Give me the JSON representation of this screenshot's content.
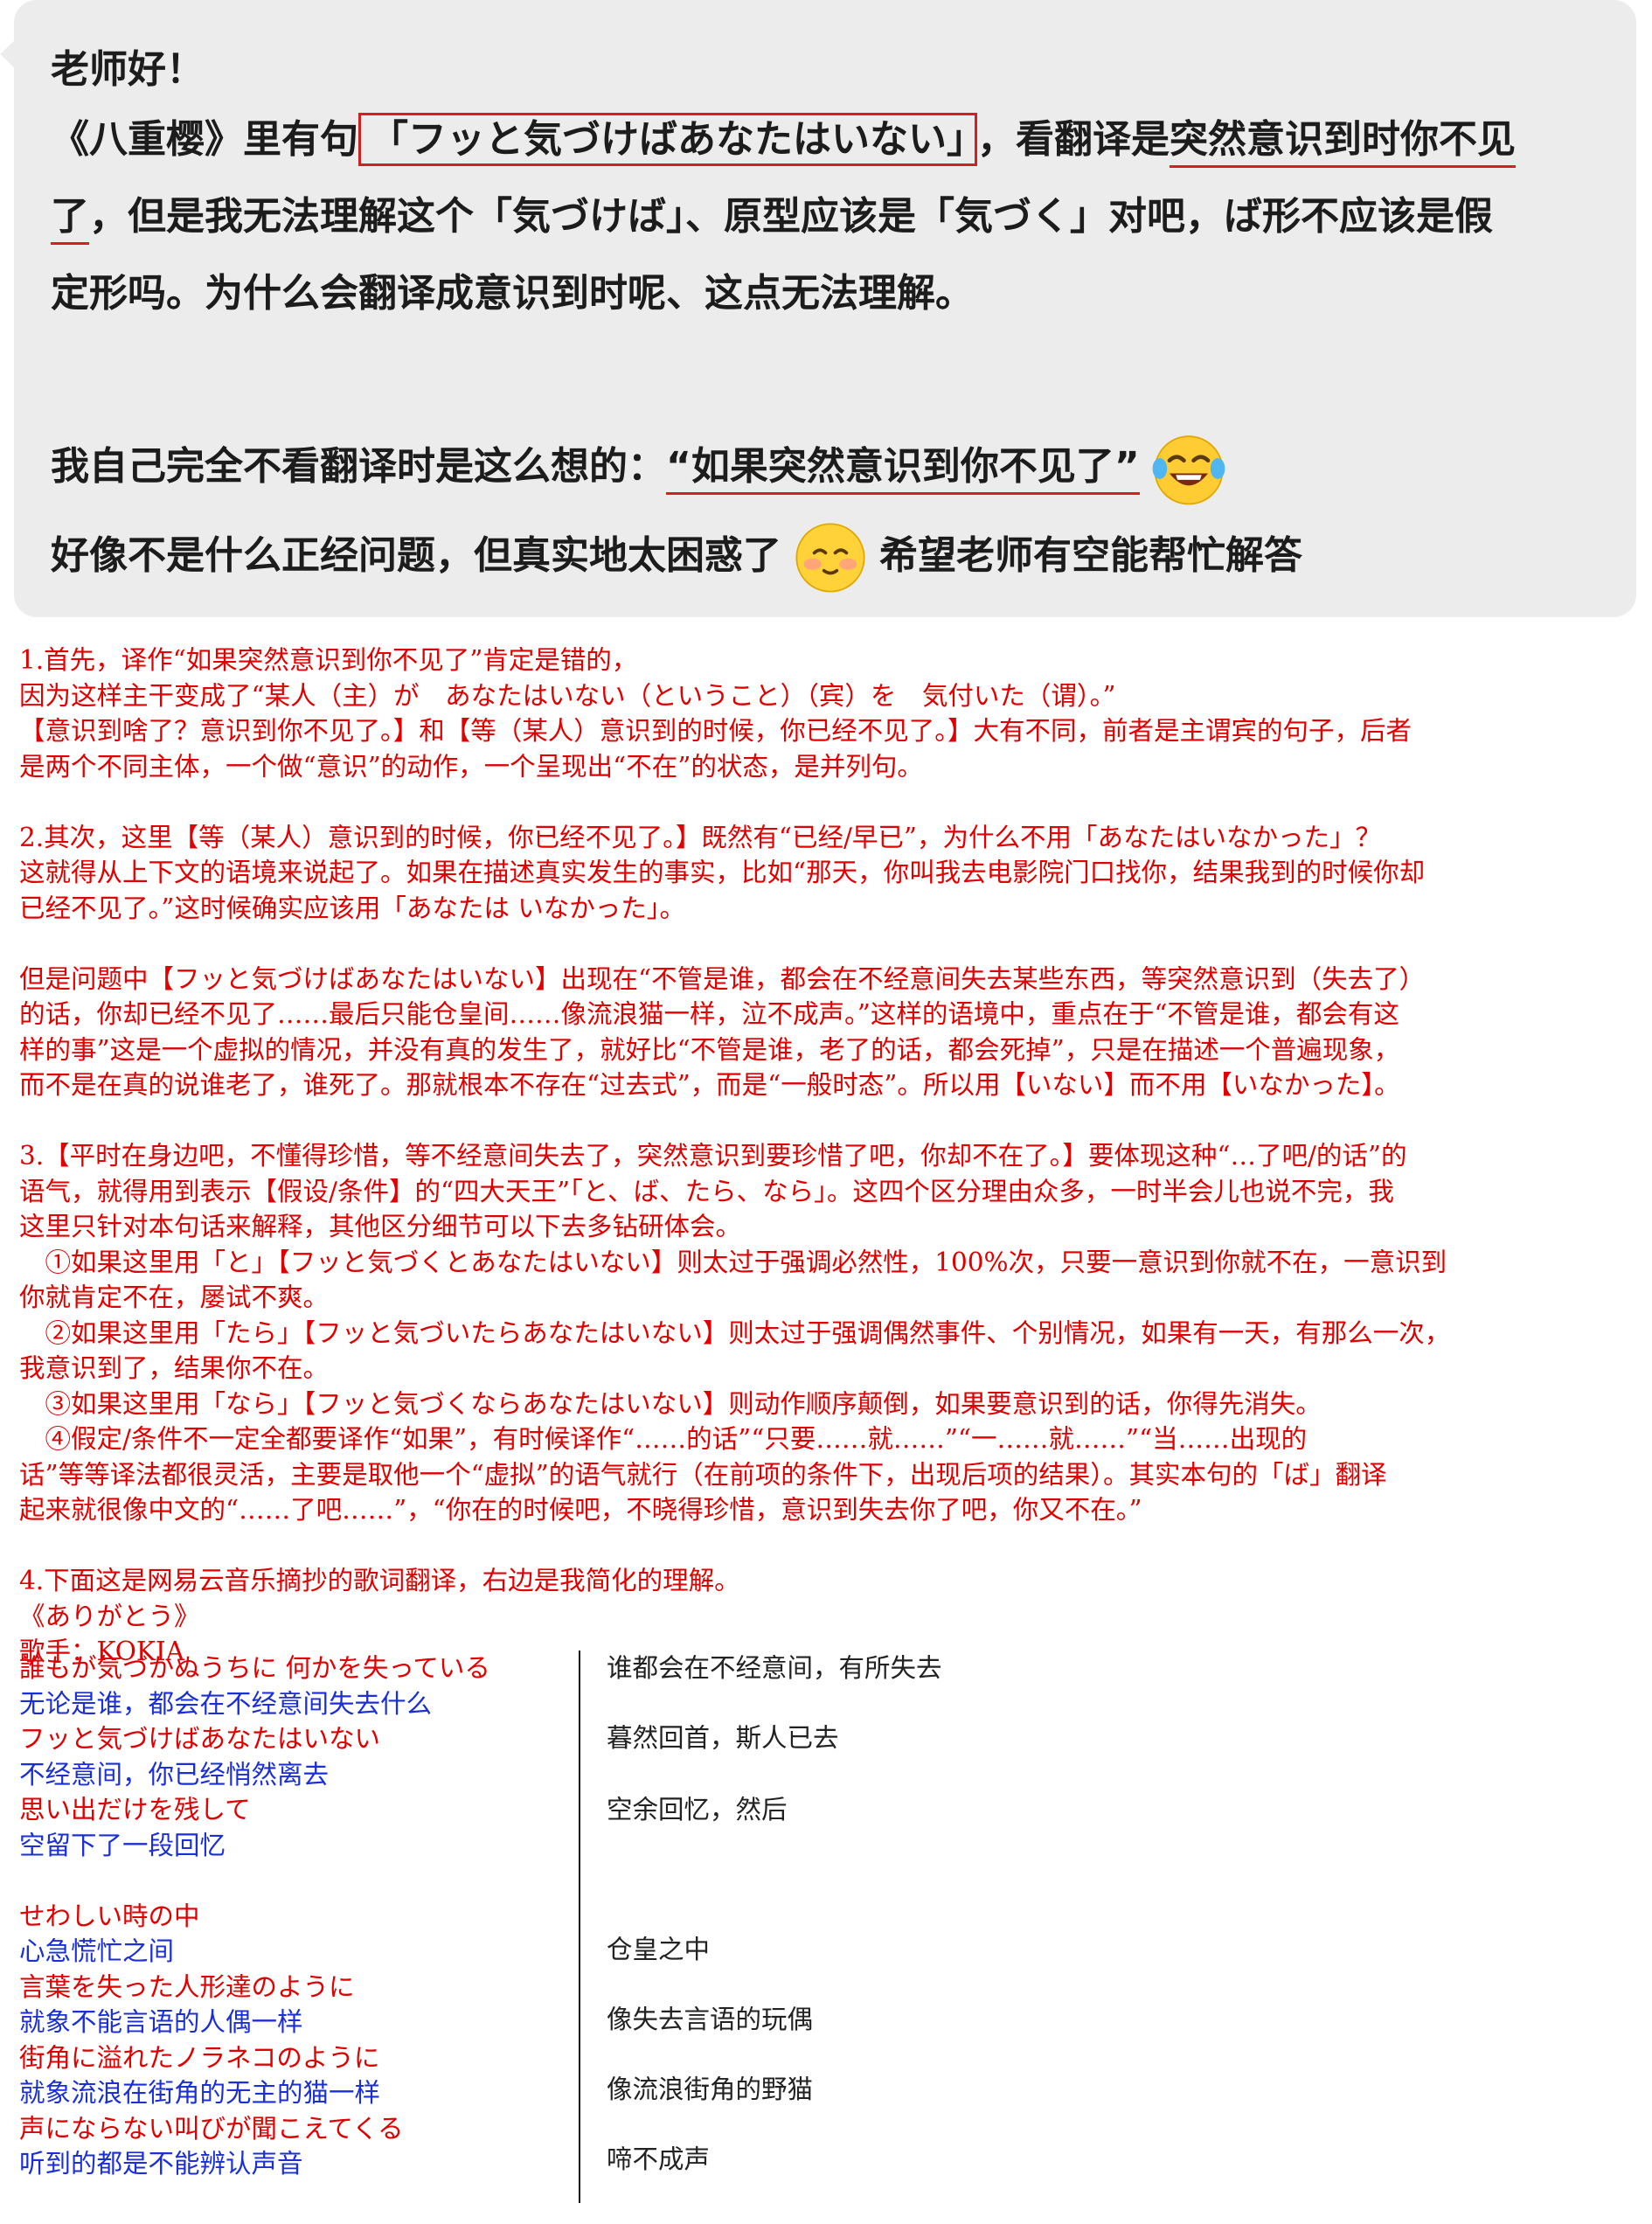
{
  "question": {
    "greeting": "老师好！",
    "line2_pre": "《八重樱》里有句",
    "line2_boxed": "「フッと気づけばあなたはいない」",
    "line2_mid": "，看翻译是",
    "line2_underlined": "突然意识到时你不见",
    "line3_underlined": "了",
    "line3_rest": "，但是我无法理解这个「気づけば」、原型应该是「気づく」对吧，ば形不应该是假",
    "line4": "定形吗。为什么会翻译成意识到时呢、这点无法理解。",
    "line5_pre": "我自己完全不看翻译时是这么想的：",
    "line5_underlined": "“如果突然意识到你不见了”",
    "line6_pre": "好像不是什么正经问题，但真实地太困惑了",
    "line6_post": "希望老师有空能帮忙解答",
    "emoji_1": "laughing-tears-emoji",
    "emoji_2": "blushing-emoji"
  },
  "answer": {
    "s1": [
      "1.首先，译作“如果突然意识到你不见了”肯定是错的，",
      "因为这样主干变成了“某人（主）が　あなたはいない（ということ）（宾）を　気付いた（谓）。”",
      "【意识到啥了？意识到你不见了。】和【等（某人）意识到的时候，你已经不见了。】大有不同，前者是主谓宾的句子，后者",
      "是两个不同主体，一个做“意识”的动作，一个呈现出“不在”的状态，是并列句。"
    ],
    "s2": [
      "2.其次，这里【等（某人）意识到的时候，你已经不见了。】既然有“已经/早已”，为什么不用「あなたはいなかった」？",
      "这就得从上下文的语境来说起了。如果在描述真实发生的事实，比如“那天，你叫我去电影院门口找你，结果我到的时候你却",
      "已经不见了。”这时候确实应该用「あなたは いなかった」。"
    ],
    "s2b": [
      "但是问题中【フッと気づけばあなたはいない】出现在“不管是谁，都会在不经意间失去某些东西，等突然意识到（失去了）",
      "的话，你却已经不见了……最后只能仓皇间……像流浪猫一样，泣不成声。”这样的语境中，重点在于“不管是谁，都会有这",
      "样的事”这是一个虚拟的情况，并没有真的发生了，就好比“不管是谁，老了的话，都会死掉”，只是在描述一个普遍现象，",
      "而不是在真的说谁老了，谁死了。那就根本不存在“过去式”，而是“一般时态”。所以用【いない】而不用【いなかった】。"
    ],
    "s3": [
      "3.【平时在身边吧，不懂得珍惜，等不经意间失去了，突然意识到要珍惜了吧，你却不在了。】要体现这种“…了吧/的话”的",
      "语气，就得用到表示【假设/条件】的“四大天王”「と、ば、たら、なら」。这四个区分理由众多，一时半会儿也说不完，我",
      "这里只针对本句话来解释，其他区分细节可以下去多钻研体会。",
      "　①如果这里用「と」【フッと気づくとあなたはいない】则太过于强调必然性，100%次，只要一意识到你就不在，一意识到",
      "你就肯定不在，屡试不爽。",
      "　②如果这里用「たら」【フッと気づいたらあなたはいない】则太过于强调偶然事件、个别情况，如果有一天，有那么一次，",
      "我意识到了，结果你不在。",
      "　③如果这里用「なら」【フッと気づくならあなたはいない】则动作顺序颠倒，如果要意识到的话，你得先消失。",
      "　④假定/条件不一定全都要译作“如果”，有时候译作“……的话”“只要……就……”“一……就……”“当……出现的",
      "话”等等译法都很灵活，主要是取他一个“虚拟”的语气就行（在前项的条件下，出现后项的结果）。其实本句的「ば」翻译",
      "起来就很像中文的“……了吧……”，“你在的时候吧，不晓得珍惜，意识到失去你了吧，你又不在。”"
    ],
    "s4": [
      "4.下面这是网易云音乐摘抄的歌词翻译，右边是我简化的理解。",
      "《ありがとう》",
      "歌手：KOKIA"
    ]
  },
  "lyrics": {
    "block1": [
      {
        "jp": "誰もが気づかぬうちに 何かを失っている",
        "cn": "无论是谁，都会在不经意间失去什么"
      },
      {
        "jp": "フッと気づけばあなたはいない",
        "cn": "不经意间，你已经悄然离去"
      },
      {
        "jp": "思い出だけを残して",
        "cn": "空留下了一段回忆"
      }
    ],
    "block2": [
      {
        "jp": "せわしい時の中",
        "cn": "心急慌忙之间"
      },
      {
        "jp": "言葉を失った人形達のように",
        "cn": "就象不能言语的人偶一样"
      },
      {
        "jp": "街角に溢れたノラネコのように",
        "cn": "就象流浪在街角的无主的猫一样"
      },
      {
        "jp": "声にならない叫びが聞こえてくる",
        "cn": "听到的都是不能辨认声音"
      }
    ],
    "simplified": [
      "谁都会在不经意间，有所失去",
      "暮然回首，斯人已去",
      "空余回忆，然后",
      "仓皇之中",
      "像失去言语的玩偶",
      "像流浪街角的野猫",
      "啼不成声"
    ]
  }
}
